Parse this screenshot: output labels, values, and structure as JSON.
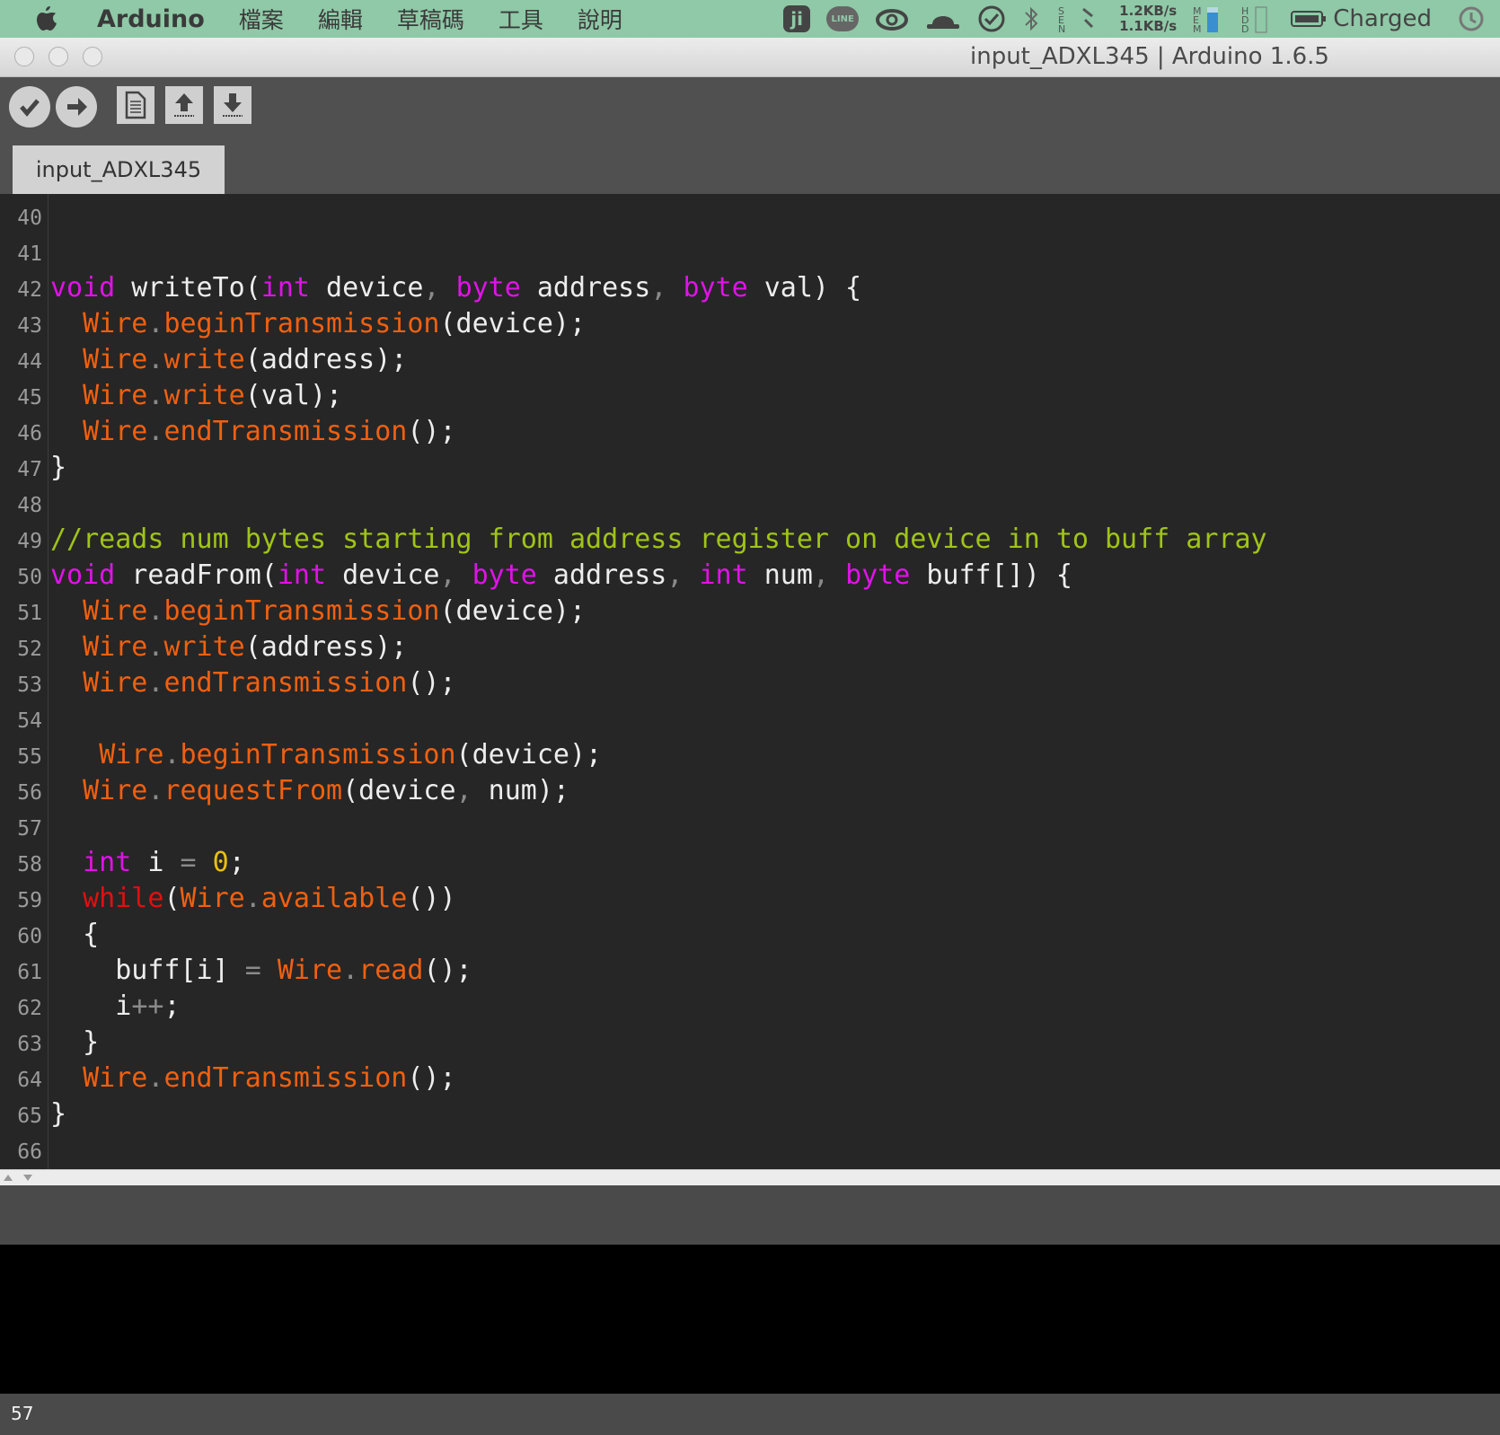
{
  "menubar": {
    "app_name": "Arduino",
    "items": [
      "檔案",
      "編輯",
      "草稿碼",
      "工具",
      "說明"
    ],
    "network_up": "1.2KB/s",
    "network_down": "1.1KB/s",
    "battery_status": "Charged"
  },
  "window": {
    "title": "input_ADXL345 | Arduino 1.6.5"
  },
  "toolbar": {
    "buttons": [
      "verify-icon",
      "upload-icon",
      "new-icon",
      "open-icon",
      "save-icon"
    ]
  },
  "tab": {
    "label": "input_ADXL345"
  },
  "editor": {
    "line_numbers": [
      "40",
      "41",
      "42",
      "43",
      "44",
      "45",
      "46",
      "47",
      "48",
      "49",
      "50",
      "51",
      "52",
      "53",
      "54",
      "55",
      "56",
      "57",
      "58",
      "59",
      "60",
      "61",
      "62",
      "63",
      "64",
      "65",
      "66"
    ]
  },
  "status": {
    "current_line": "57"
  },
  "colors": {
    "keyword": "#e012e8",
    "function": "#f06010",
    "comment": "#a0c418",
    "number": "#e8c010",
    "control": "#e01010",
    "editor_bg": "#262626"
  }
}
